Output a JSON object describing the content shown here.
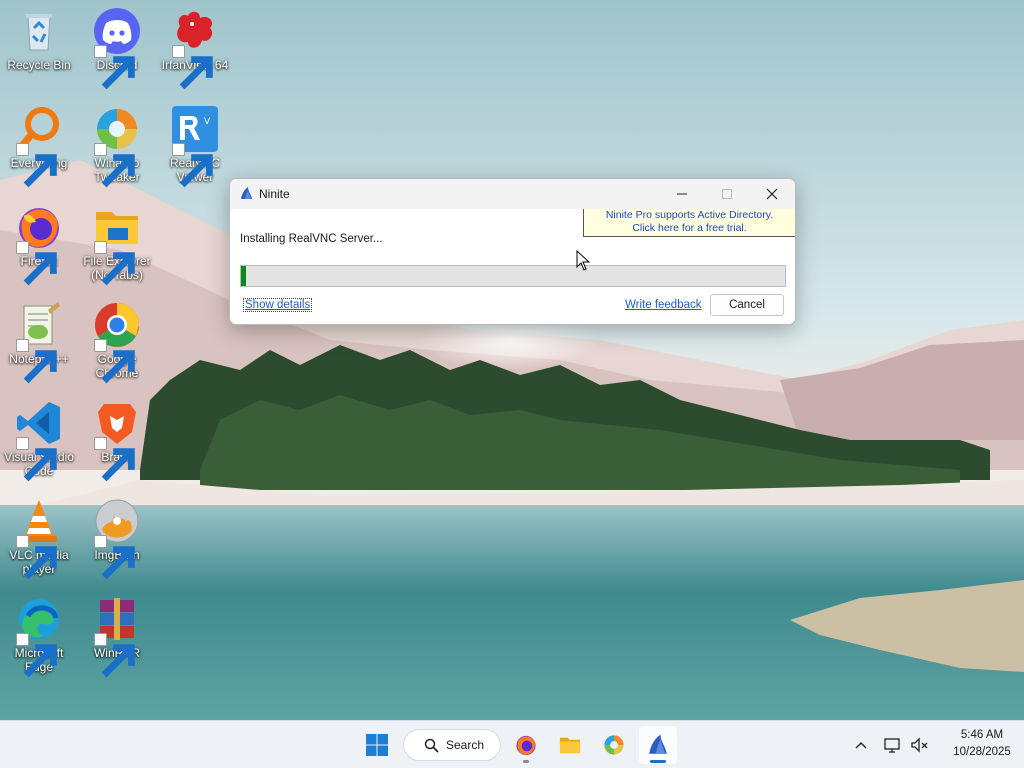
{
  "desktop": {
    "icons": [
      {
        "label": "Recycle Bin"
      },
      {
        "label": "Discord"
      },
      {
        "label": "IrfanView 64"
      },
      {
        "label": "Everything"
      },
      {
        "label": "Winaero\nTweaker"
      },
      {
        "label": "RealVNC\nViewer"
      },
      {
        "label": "Firefox"
      },
      {
        "label": "File Explorer\n(No Tabs)"
      },
      {
        "label": "Notepad++"
      },
      {
        "label": "Google\nChrome"
      },
      {
        "label": "Visual Studio\nCode"
      },
      {
        "label": "Brave"
      },
      {
        "label": "VLC media\nplayer"
      },
      {
        "label": "ImgBurn"
      },
      {
        "label": "Microsoft\nEdge"
      },
      {
        "label": "WinRAR"
      }
    ]
  },
  "window": {
    "title": "Ninite",
    "ad_line1": "Ninite Pro supports Active Directory.",
    "ad_line2": "Click here for a free trial.",
    "status": "Installing RealVNC Server...",
    "progress": 0.01,
    "show_details": "Show details",
    "write_feedback": "Write feedback",
    "cancel": "Cancel",
    "progress_color": "#0d8a1d"
  },
  "taskbar": {
    "search_label": "Search",
    "time": "5:46 AM",
    "date": "10/28/2025",
    "apps": [
      "windows-start-icon",
      "firefox-icon",
      "file-explorer-icon",
      "winaero-tweaker-icon",
      "ninite-icon"
    ]
  }
}
